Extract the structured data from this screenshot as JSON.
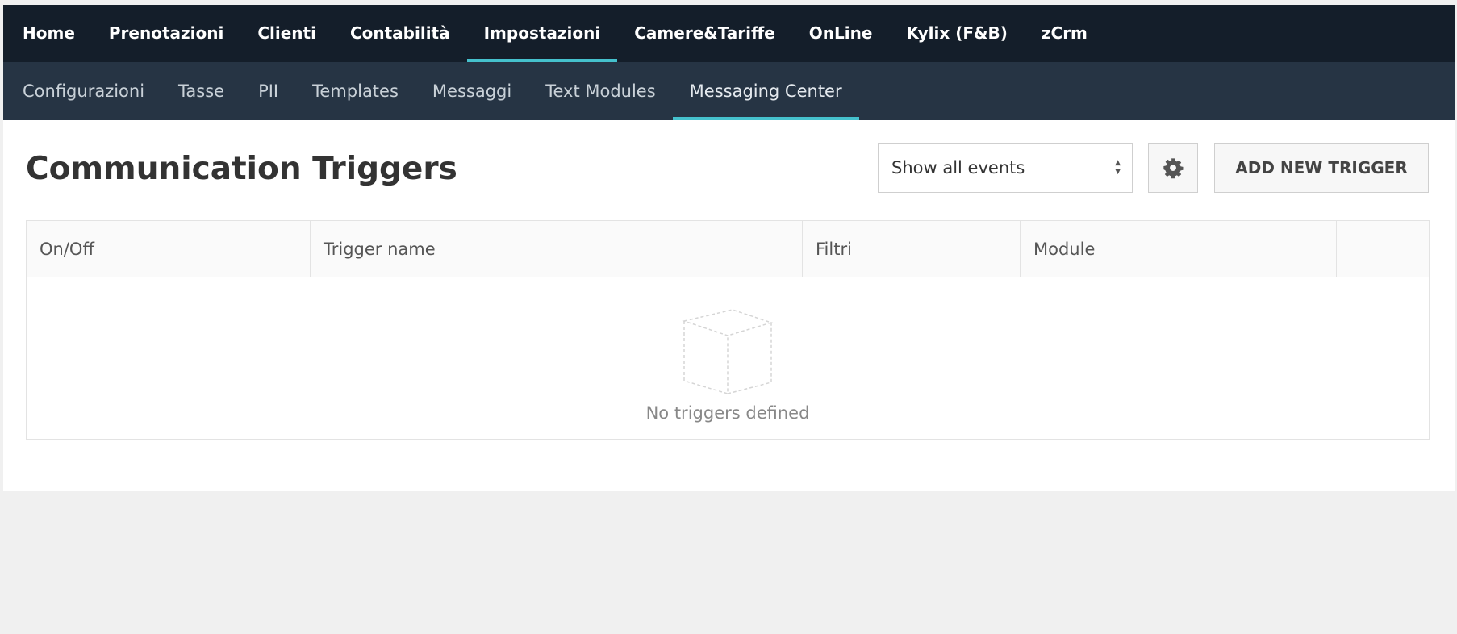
{
  "top_nav": {
    "items": [
      {
        "label": "Home"
      },
      {
        "label": "Prenotazioni"
      },
      {
        "label": "Clienti"
      },
      {
        "label": "Contabilità"
      },
      {
        "label": "Impostazioni",
        "active": true
      },
      {
        "label": "Camere&Tariffe"
      },
      {
        "label": "OnLine"
      },
      {
        "label": "Kylix (F&B)"
      },
      {
        "label": "zCrm"
      }
    ]
  },
  "sub_nav": {
    "items": [
      {
        "label": "Configurazioni"
      },
      {
        "label": "Tasse"
      },
      {
        "label": "PII"
      },
      {
        "label": "Templates"
      },
      {
        "label": "Messaggi"
      },
      {
        "label": "Text Modules"
      },
      {
        "label": "Messaging Center",
        "active": true
      }
    ]
  },
  "page": {
    "title": "Communication Triggers",
    "event_filter": {
      "selected": "Show all events"
    },
    "settings_icon": "gear-icon",
    "add_button_label": "ADD NEW TRIGGER"
  },
  "table": {
    "columns": [
      "On/Off",
      "Trigger name",
      "Filtri",
      "Module",
      ""
    ],
    "empty_icon": "empty-box-icon",
    "empty_message": "No triggers defined"
  },
  "colors": {
    "top_nav_bg": "#141e2a",
    "sub_nav_bg": "#263444",
    "accent": "#45c1cd",
    "background": "#f0f0f0"
  }
}
